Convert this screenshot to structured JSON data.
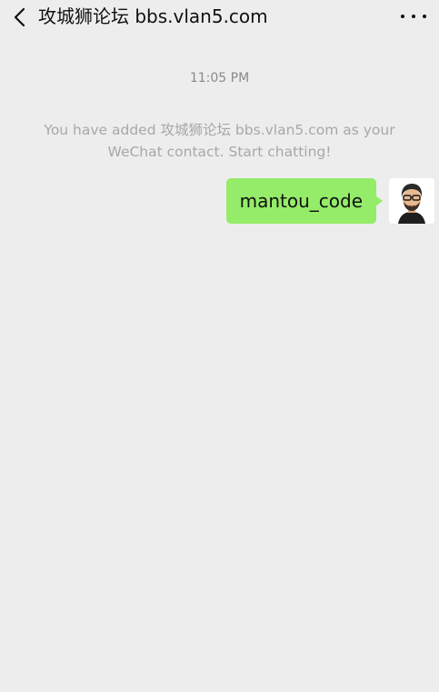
{
  "header": {
    "back_icon": "chevron-left-icon",
    "title": "攻城狮论坛 bbs.vlan5.com",
    "more_icon": "more-horizontal-icon"
  },
  "chat": {
    "timestamp": "11:05 PM",
    "system_message": "You have added 攻城狮论坛 bbs.vlan5.com as your WeChat contact. Start chatting!",
    "messages": [
      {
        "sender": "me",
        "text": "mantou_code"
      }
    ]
  },
  "colors": {
    "background": "#ededed",
    "sent_bubble": "#95ec69",
    "system_text": "#a8a8a8",
    "timestamp_text": "#8a8a8a"
  }
}
